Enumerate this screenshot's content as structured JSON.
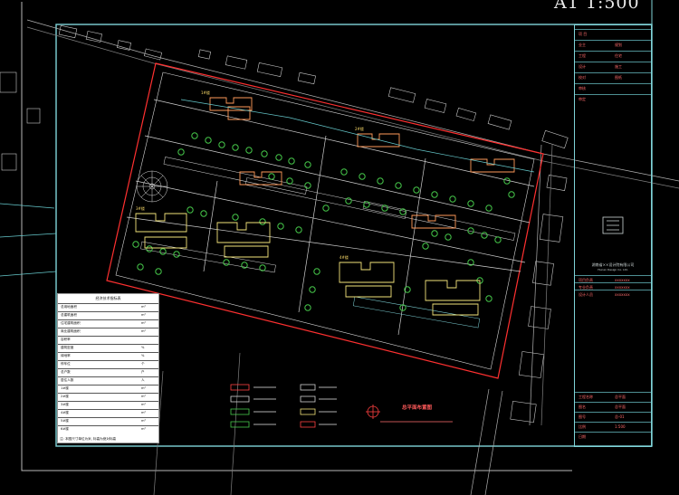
{
  "drawing": {
    "scale_title": "A1 1:500",
    "plan_title": "总平面布置图"
  },
  "title_block": {
    "rows_top": [
      {
        "k": "项 目",
        "v": ""
      },
      {
        "k": "业主",
        "v": "规划"
      },
      {
        "k": "工程",
        "v": "住宅"
      },
      {
        "k": "设计",
        "v": "施工"
      },
      {
        "k": "校对",
        "v": "图纸"
      },
      {
        "k": "审核",
        "v": ""
      },
      {
        "k": "审定",
        "v": ""
      }
    ],
    "company_name": "湖南省××设计院有限公司",
    "company_en": "Hunan Design Co. Ltd.",
    "rows_mid": [
      {
        "k": "项目负责",
        "v": "xxxxxxx"
      },
      {
        "k": "专业负责",
        "v": "xxxxxxx"
      },
      {
        "k": "设计人员",
        "v": "xxxxxxx"
      }
    ],
    "rows_bottom": [
      {
        "k": "工程名称",
        "v": "总平面"
      },
      {
        "k": "图名",
        "v": "总平面"
      },
      {
        "k": "图号",
        "v": "总-01"
      },
      {
        "k": "比例",
        "v": "1:500"
      },
      {
        "k": "日期",
        "v": ""
      }
    ]
  },
  "legend_table": {
    "title": "经济技术指标表",
    "rows": [
      {
        "k": "总用地面积",
        "v": "",
        "u": "m²"
      },
      {
        "k": "总建筑面积",
        "v": "",
        "u": "m²"
      },
      {
        "k": "住宅建筑面积",
        "v": "",
        "u": "m²"
      },
      {
        "k": "商业建筑面积",
        "v": "",
        "u": "m²"
      },
      {
        "k": "容积率",
        "v": "",
        "u": ""
      },
      {
        "k": "建筑密度",
        "v": "",
        "u": "%"
      },
      {
        "k": "绿地率",
        "v": "",
        "u": "%"
      },
      {
        "k": "停车位",
        "v": "",
        "u": "个"
      },
      {
        "k": "总户数",
        "v": "",
        "u": "户"
      },
      {
        "k": "居住人数",
        "v": "",
        "u": "人"
      },
      {
        "k": "1#楼",
        "v": "",
        "u": "m²"
      },
      {
        "k": "2#楼",
        "v": "",
        "u": "m²"
      },
      {
        "k": "3#楼",
        "v": "",
        "u": "m²"
      },
      {
        "k": "4#楼",
        "v": "",
        "u": "m²"
      },
      {
        "k": "5#楼",
        "v": "",
        "u": "m²"
      },
      {
        "k": "6#楼",
        "v": "",
        "u": "m²"
      }
    ],
    "note": "注: 本图尺寸单位为米, 标高为绝对标高"
  },
  "building_labels": [
    "1#楼",
    "2#楼",
    "3#楼",
    "4#楼"
  ],
  "colors": {
    "border_cyan": "#7fd3d8",
    "site_red": "#ff3030",
    "building_orange": "#ff9a5a",
    "building_yellow": "#f2e37a",
    "tree_green": "#46c84a",
    "road_white": "#d0d0d0"
  }
}
